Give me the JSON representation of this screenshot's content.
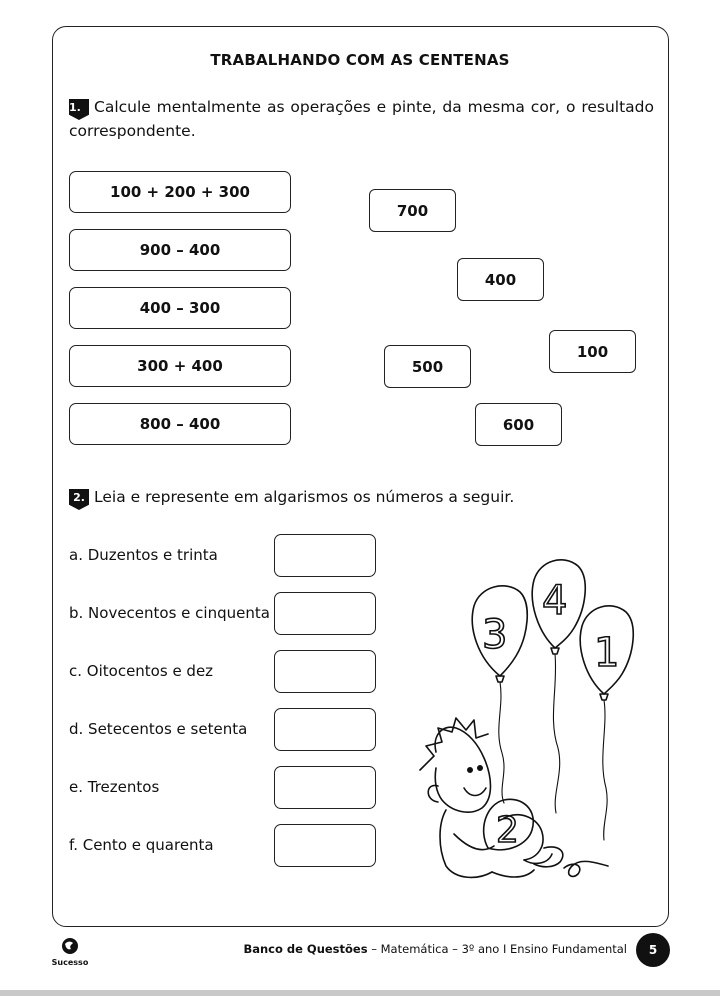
{
  "title": "TRABALHANDO COM AS CENTENAS",
  "q1": {
    "number": "1.",
    "text_line1": "Calcule mentalmente as operações e pinte, da mesma cor, o resultado",
    "text_line2": "correspondente.",
    "operations": [
      "100 + 200 + 300",
      "900 – 400",
      "400 – 300",
      "300 + 400",
      "800 – 400"
    ],
    "results": [
      "700",
      "400",
      "100",
      "500",
      "600"
    ]
  },
  "q2": {
    "number": "2.",
    "text": "Leia e represente em algarismos os números a seguir.",
    "items": [
      "a. Duzentos e trinta",
      "b. Novecentos e cinquenta",
      "c. Oitocentos e dez",
      "d. Setecentos e setenta",
      "e. Trezentos",
      "f. Cento e quarenta"
    ]
  },
  "illustration": {
    "balloon_digits": [
      "3",
      "4",
      "1"
    ],
    "held_balloon_digit": "2"
  },
  "footer": {
    "logo": "Sucesso",
    "book": "Banco de Questões",
    "rest": " – Matemática – 3º ano I Ensino Fundamental",
    "page": "5"
  }
}
